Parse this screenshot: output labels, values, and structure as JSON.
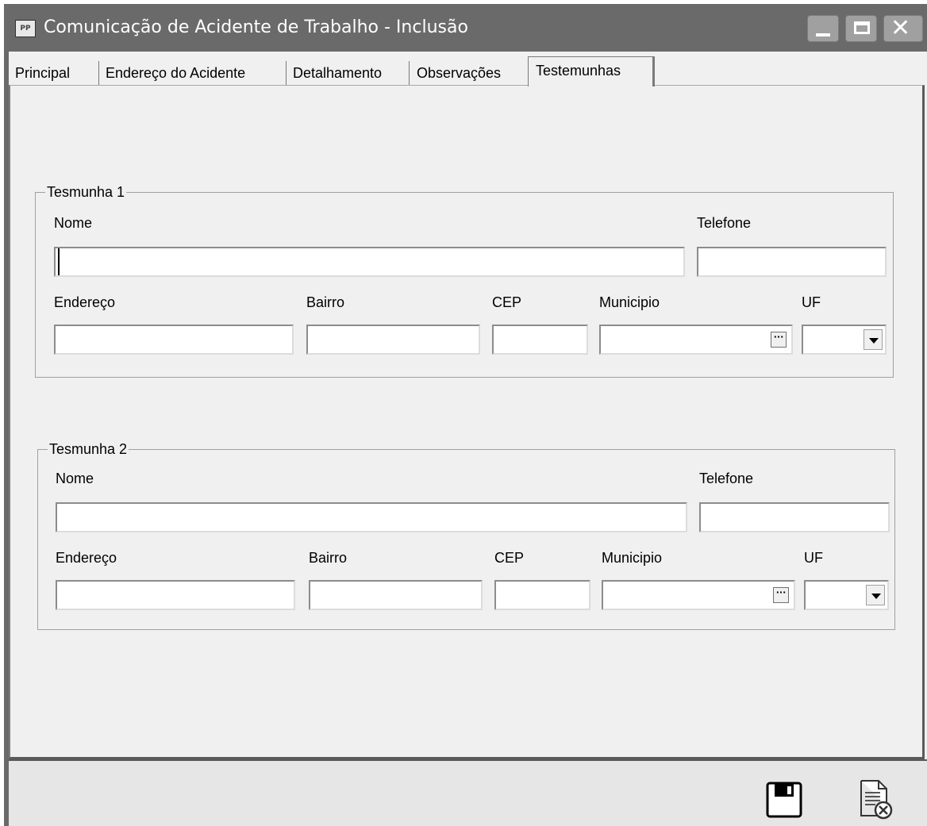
{
  "window": {
    "title": "Comunicação de Acidente de Trabalho - Inclusão",
    "app_icon_text": "PP",
    "controls": {
      "minimize_icon": "minimize-icon",
      "maximize_icon": "maximize-icon",
      "close_icon": "close-icon",
      "close_glyph": "✕"
    }
  },
  "tabs": [
    {
      "label": "Principal",
      "active": false
    },
    {
      "label": "Endereço do Acidente",
      "active": false
    },
    {
      "label": "Detalhamento",
      "active": false
    },
    {
      "label": "Observações",
      "active": false
    },
    {
      "label": "Testemunhas",
      "active": true
    }
  ],
  "witness1": {
    "title": "Tesmunha 1",
    "nome_label": "Nome",
    "nome_value": "",
    "telefone_label": "Telefone",
    "telefone_value": "",
    "endereco_label": "Endereço",
    "endereco_value": "",
    "bairro_label": "Bairro",
    "bairro_value": "",
    "cep_label": "CEP",
    "cep_value": "",
    "municipio_label": "Municipio",
    "municipio_value": "",
    "uf_label": "UF",
    "uf_value": "",
    "ellipsis": "···"
  },
  "witness2": {
    "title": "Tesmunha 2",
    "nome_label": "Nome",
    "nome_value": "",
    "telefone_label": "Telefone",
    "telefone_value": "",
    "endereco_label": "Endereço",
    "endereco_value": "",
    "bairro_label": "Bairro",
    "bairro_value": "",
    "cep_label": "CEP",
    "cep_value": "",
    "municipio_label": "Municipio",
    "municipio_value": "",
    "uf_label": "UF",
    "uf_value": "",
    "ellipsis": "···"
  },
  "footer": {
    "save_icon": "save-icon",
    "cancel_icon": "cancel-document-icon"
  },
  "colors": {
    "titlebar": "#6a6a6a",
    "client": "#f0f0f0",
    "footer": "#e6e6e6"
  }
}
